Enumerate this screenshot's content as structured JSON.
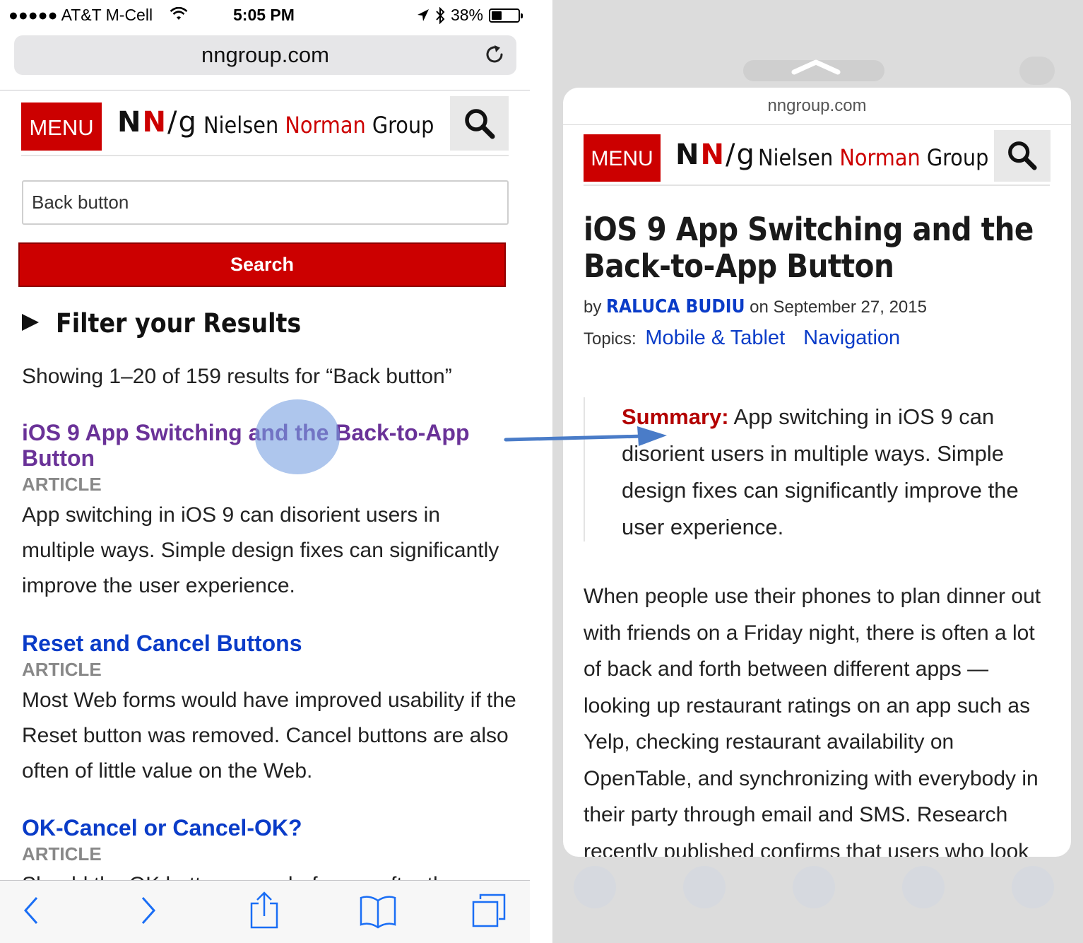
{
  "left": {
    "status": {
      "carrier": "●●●●● AT&T M-Cell",
      "time": "5:05 PM",
      "battery": "38%",
      "battery_level": 0.38
    },
    "address_bar": {
      "url": "nngroup.com"
    },
    "header": {
      "menu_label": "MENU",
      "logo_mark_n1": "N",
      "logo_mark_n2": "N",
      "logo_mark_g": "/g",
      "logo_name_1": "Nielsen ",
      "logo_name_2": "Norman",
      "logo_name_3": " Group"
    },
    "search": {
      "value": "Back button",
      "button_label": "Search"
    },
    "filter_label": "Filter your Results",
    "showing_text": "Showing 1–20 of 159 results for “Back button”",
    "results": [
      {
        "title": "iOS 9 App Switching and the Back-to-App Button",
        "type": "ARTICLE",
        "description": "App switching in iOS 9 can disorient users in multiple ways. Simple design fixes can significantly improve the user experience."
      },
      {
        "title": "Reset and Cancel Buttons",
        "type": "ARTICLE",
        "description": "Most Web forms would have improved usability if the Reset button was removed. Cancel buttons are also often of little value on the Web."
      },
      {
        "title": "OK-Cancel or Cancel-OK?",
        "type": "ARTICLE",
        "description": "Should the OK button come before or after the"
      }
    ],
    "toolbar": {
      "back_icon": "chevron-left-icon",
      "forward_icon": "chevron-right-icon",
      "share_icon": "share-icon",
      "bookmarks_icon": "book-icon",
      "tabs_icon": "tabs-icon"
    }
  },
  "right": {
    "preview": {
      "url": "nngroup.com",
      "header": {
        "menu_label": "MENU",
        "logo_mark_n1": "N",
        "logo_mark_n2": "N",
        "logo_mark_g": "/g",
        "logo_name_1": "Nielsen ",
        "logo_name_2": "Norman",
        "logo_name_3": " Group"
      },
      "title": "iOS 9 App Switching and the Back-to-App Button",
      "byline_prefix": "by ",
      "author": "RALUCA BUDIU",
      "byline_date": " on September 27, 2015",
      "topics_label": "Topics:",
      "topics": [
        "Mobile & Tablet",
        "Navigation"
      ],
      "summary_label": "Summary:",
      "summary_text": " App switching in iOS 9 can disorient users in multiple ways. Simple design fixes can significantly improve the user experience.",
      "body": "When people use their phones to plan dinner out with friends on a Friday night, there is often a lot of back and forth between different apps — looking up restaurant ratings on an app such as Yelp, checking restaurant availability on OpenTable, and synchronizing with everybody in their party through email and SMS. Research recently published confirms that users who look"
    }
  },
  "colors": {
    "brand_red": "#cc0000",
    "link_blue": "#0a3cc8",
    "visited_purple": "#6a3298",
    "arrow_blue": "#4a7cc8",
    "tap_highlight": "#78a0e1"
  }
}
